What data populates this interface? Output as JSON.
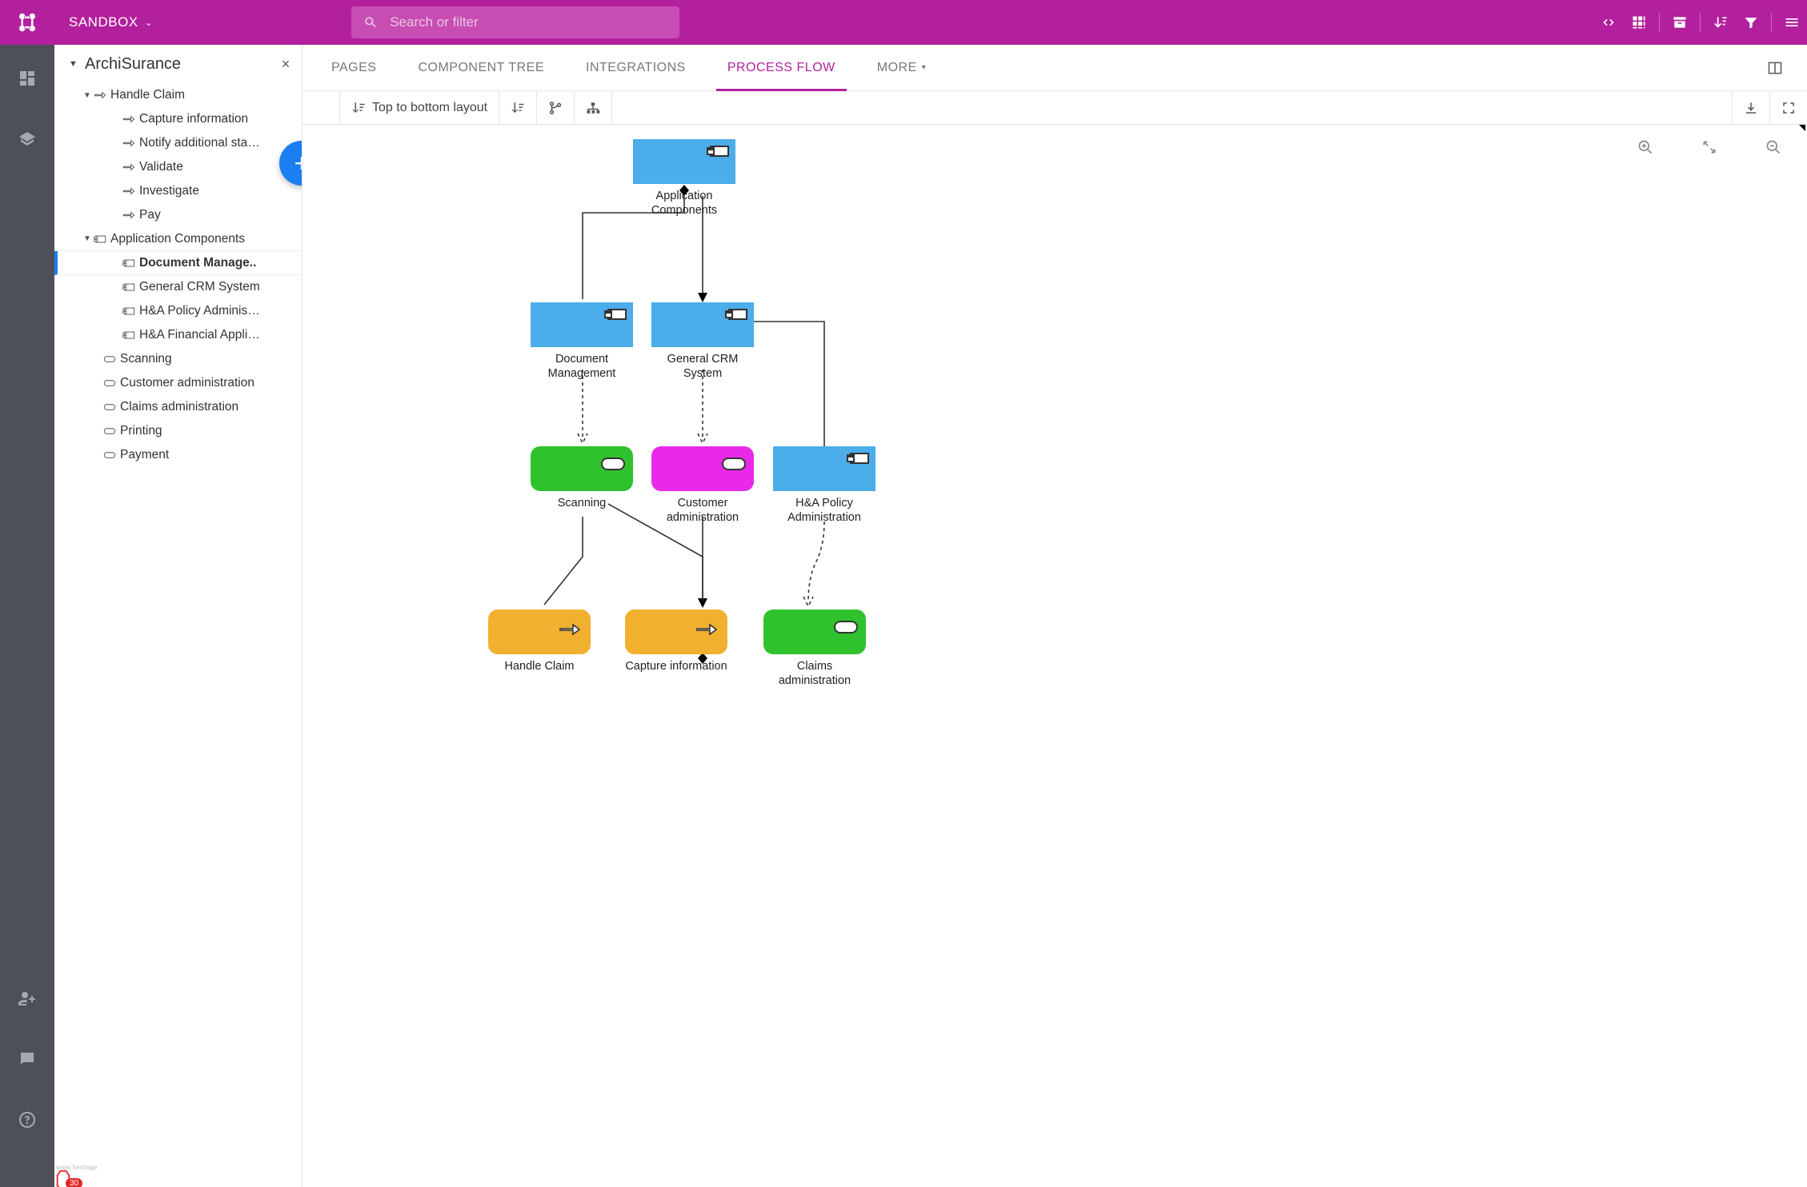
{
  "header": {
    "workspace": "SANDBOX",
    "search_placeholder": "Search or filter"
  },
  "sidebar_tree": {
    "title": "ArchiSurance",
    "nodes": {
      "handle_claim": "Handle Claim",
      "capture_info": "Capture information",
      "notify": "Notify additional sta…",
      "validate": "Validate",
      "investigate": "Investigate",
      "pay": "Pay",
      "app_components": "Application Components",
      "doc_manage": "Document Manage..",
      "general_crm": "General CRM System",
      "ha_policy": "H&A Policy Adminis…",
      "ha_financial": "H&A Financial Appli…",
      "scanning": "Scanning",
      "cust_admin": "Customer administration",
      "claims_admin": "Claims administration",
      "printing": "Printing",
      "payment": "Payment"
    }
  },
  "tabs": {
    "pages": "PAGES",
    "component_tree": "COMPONENT TREE",
    "integrations": "INTEGRATIONS",
    "process_flow": "PROCESS FLOW",
    "more": "MORE"
  },
  "toolbar": {
    "layout_label": "Top to bottom layout"
  },
  "diagram": {
    "app_components": "Application Components",
    "doc_manage": "Document Management",
    "general_crm": "General CRM System",
    "scanning": "Scanning",
    "cust_admin": "Customer administration",
    "ha_policy": "H&A Policy Administration",
    "handle_claim": "Handle Claim",
    "capture_info": "Capture information",
    "claims_admin": "Claims administration"
  },
  "badge": {
    "count": "30"
  }
}
